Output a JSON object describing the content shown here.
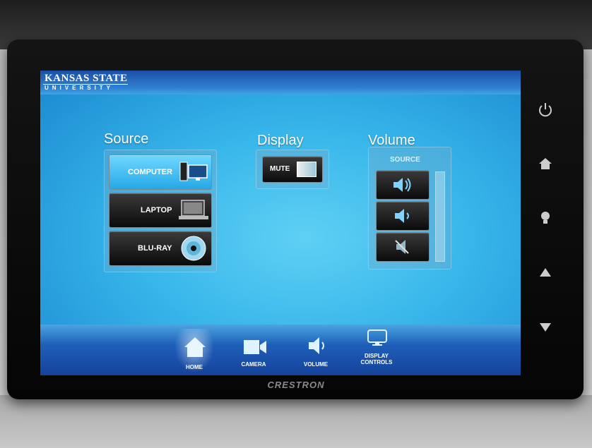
{
  "header": {
    "logo_main": "KANSAS STATE",
    "logo_sub": "UNIVERSITY"
  },
  "source": {
    "heading": "Source",
    "items": [
      {
        "label": "COMPUTER",
        "icon": "computer-icon",
        "selected": true
      },
      {
        "label": "LAPTOP",
        "icon": "laptop-icon",
        "selected": false
      },
      {
        "label": "BLU-RAY",
        "icon": "disc-icon",
        "selected": false
      }
    ]
  },
  "display": {
    "heading": "Display",
    "mute_label": "MUTE"
  },
  "volume": {
    "heading": "Volume",
    "source_label": "SOURCE",
    "buttons": [
      "volume-up-icon",
      "volume-down-icon",
      "volume-mute-icon"
    ]
  },
  "nav": [
    {
      "label": "HOME",
      "icon": "home-icon",
      "active": true
    },
    {
      "label": "CAMERA",
      "icon": "camera-icon",
      "active": false
    },
    {
      "label": "VOLUME",
      "icon": "speaker-icon",
      "active": false
    },
    {
      "label": "DISPLAY CONTROLS",
      "icon": "monitor-icon",
      "active": false
    }
  ],
  "hardware_buttons": [
    "power-icon",
    "home-icon",
    "light-icon",
    "arrow-up-icon",
    "arrow-down-icon"
  ],
  "device_brand": "CRESTRON",
  "colors": {
    "accent": "#37b6ea",
    "bar": "#1f5fb9",
    "selected": "#6fd8ff"
  }
}
